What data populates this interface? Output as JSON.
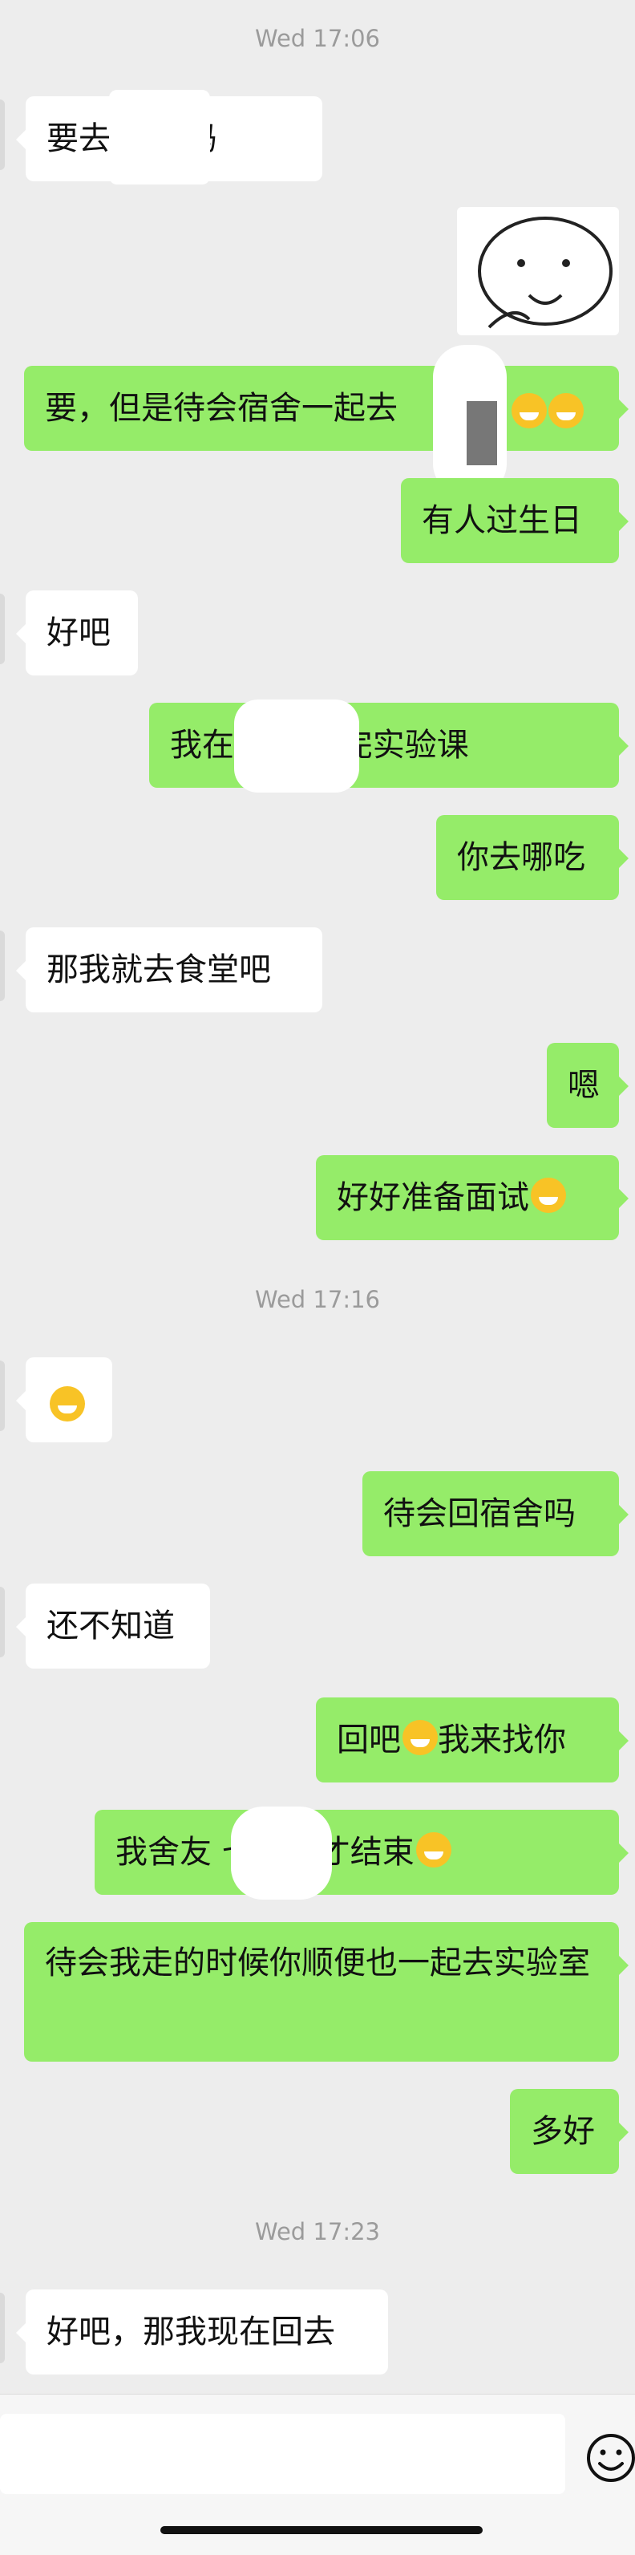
{
  "chat": {
    "timestamps": [
      "Wed 17:06",
      "Wed 17:16",
      "Wed 17:23"
    ],
    "messages": [
      {
        "from": "in",
        "text": "要去  吃饭吗"
      },
      {
        "from": "out",
        "text": "要，但是待会宿舍一起去"
      },
      {
        "from": "out",
        "text": "有人过生日"
      },
      {
        "from": "in",
        "text": "好吧"
      },
      {
        "from": "out",
        "text": "我在     ，刚上完实验课"
      },
      {
        "from": "out",
        "text": "你去哪吃"
      },
      {
        "from": "in",
        "text": "那我就去食堂吧"
      },
      {
        "from": "out",
        "text": "嗯"
      },
      {
        "from": "out",
        "text": "好好准备面试"
      },
      {
        "from": "out",
        "text": "待会回宿舍吗"
      },
      {
        "from": "in",
        "text": "还不知道"
      },
      {
        "from": "out",
        "text": "回吧"
      },
      {
        "from": "out",
        "text": "我来找你"
      },
      {
        "from": "out",
        "text": "我舍友     七点半才结束"
      },
      {
        "from": "out",
        "text": "待会我走的时候你顺便也一起去实验室"
      },
      {
        "from": "out",
        "text": "多好"
      },
      {
        "from": "in",
        "text": "好吧，那我现在回去"
      }
    ]
  },
  "icons": {
    "emoji": "emoji-face-icon",
    "sticker": "sticker-cartoon-icon"
  },
  "colors": {
    "background": "#ededed",
    "incoming": "#ffffff",
    "outgoing": "#95ec69",
    "timestamp": "#9b9b9b"
  }
}
